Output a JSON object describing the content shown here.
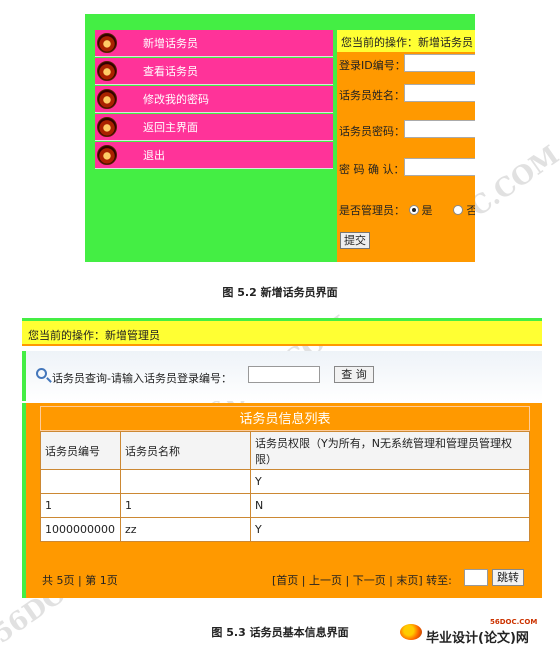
{
  "figure1": {
    "sidebar": {
      "items": [
        {
          "label": "新增话务员",
          "icon": "avatar-icon"
        },
        {
          "label": "查看话务员",
          "icon": "avatar-icon"
        },
        {
          "label": "修改我的密码",
          "icon": "avatar-icon"
        },
        {
          "label": "返回主界面",
          "icon": "avatar-icon"
        },
        {
          "label": "退出",
          "icon": "avatar-icon"
        }
      ]
    },
    "operation": "您当前的操作：新增话务员",
    "form": {
      "login_id_label": "登录ID编号：",
      "name_label": "话务员姓名：",
      "password_label": "话务员密码：",
      "confirm_label": "密 码 确 认：",
      "admin_label": "是否管理员：",
      "admin_yes": "是",
      "admin_no": "否",
      "admin_selected": "是",
      "submit_label": "提交"
    },
    "caption": "图 5.2  新增话务员界面"
  },
  "figure2": {
    "operation": "您当前的操作：新增管理员",
    "search": {
      "label": "话务员查询-请输入话务员登录编号：",
      "button": "查 询"
    },
    "table": {
      "title": "话务员信息列表",
      "headers": [
        "话务员编号",
        "话务员名称",
        "话务员权限（Y为所有，N无系统管理和管理员管理权限）"
      ],
      "rows": [
        [
          "",
          "",
          "Y"
        ],
        [
          "1",
          "1",
          "N"
        ],
        [
          "1000000000",
          "zz",
          "Y"
        ]
      ]
    },
    "pager": {
      "summary": "共 5页 | 第 1页",
      "nav": "[首页 | 上一页 | 下一页 | 末页] 转至:",
      "go": "跳转"
    },
    "caption": "图 5.3  话务员基本信息界面"
  },
  "watermark": "56DOC.COM",
  "logo": {
    "url": "56DOC.COM",
    "name": "毕业设计(论文)网"
  },
  "colors": {
    "green": "#44ee44",
    "pink": "#ff3399",
    "orange": "#ff9900",
    "yellow": "#ffff33"
  }
}
